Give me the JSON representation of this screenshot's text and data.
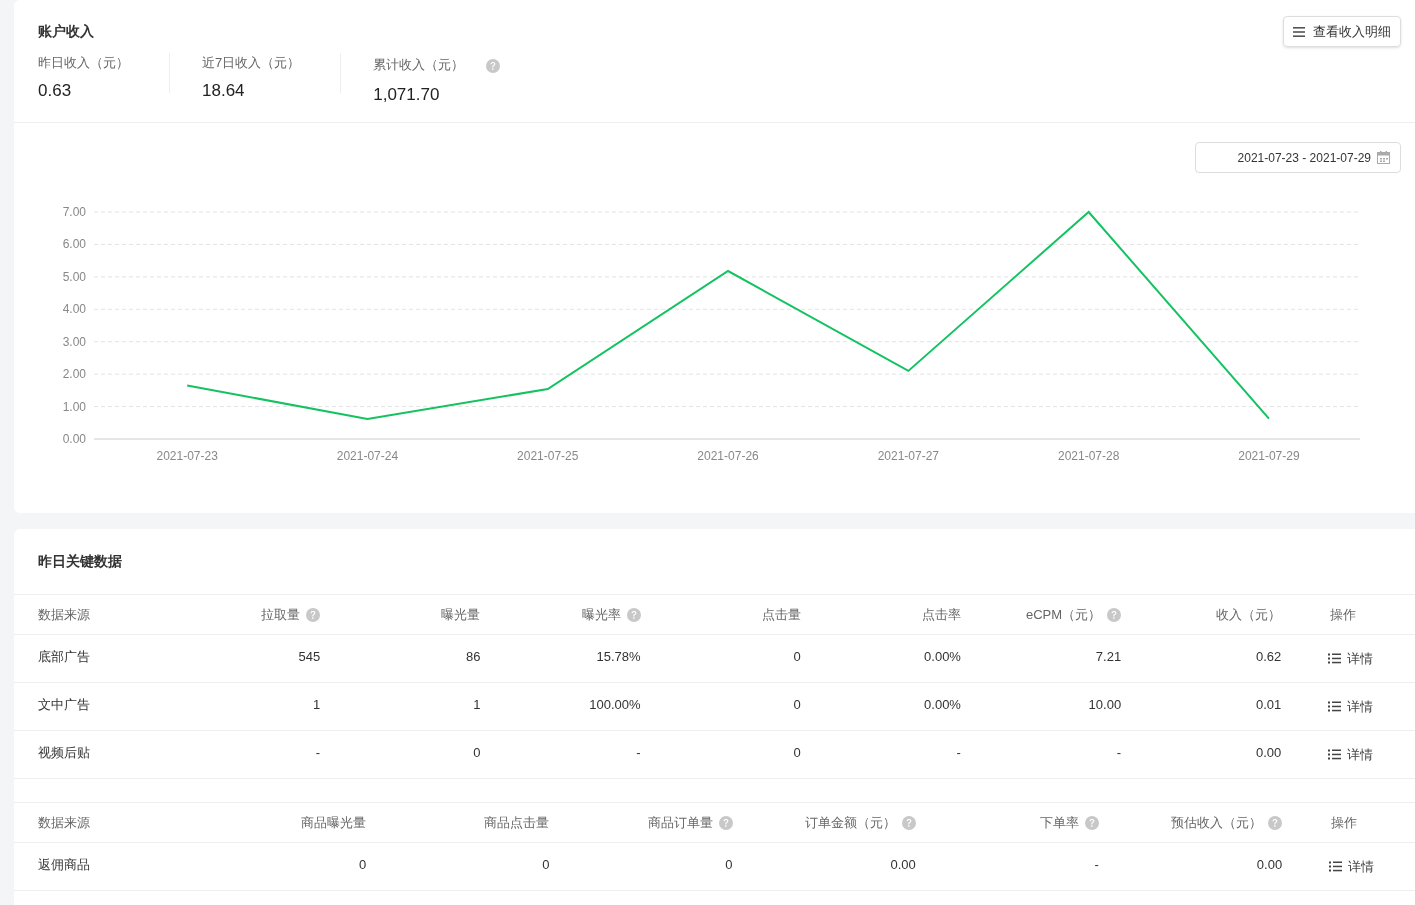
{
  "income": {
    "title": "账户收入",
    "detail_button": "查看收入明细",
    "stats": [
      {
        "label": "昨日收入（元）",
        "value": "0.63",
        "help": false
      },
      {
        "label": "近7日收入（元）",
        "value": "18.64",
        "help": false
      },
      {
        "label": "累计收入（元）",
        "value": "1,071.70",
        "help": true
      }
    ],
    "date_range": "2021-07-23 - 2021-07-29",
    "chart_data": {
      "type": "line",
      "categories": [
        "2021-07-23",
        "2021-07-24",
        "2021-07-25",
        "2021-07-26",
        "2021-07-27",
        "2021-07-28",
        "2021-07-29"
      ],
      "grid": true,
      "series": [
        {
          "color": "#13c261",
          "values": [
            1.65,
            0.62,
            1.54,
            5.18,
            2.1,
            7.0,
            0.63
          ]
        }
      ],
      "ylim": [
        0,
        7
      ],
      "yticks": [
        {
          "value": 0,
          "label": "0.00"
        },
        {
          "value": 1,
          "label": "1.00"
        },
        {
          "value": 2,
          "label": "2.00"
        },
        {
          "value": 3,
          "label": "3.00"
        },
        {
          "value": 4,
          "label": "4.00"
        },
        {
          "value": 5,
          "label": "5.00"
        },
        {
          "value": 6,
          "label": "6.00"
        },
        {
          "value": 7,
          "label": "7.00"
        }
      ]
    }
  },
  "key_data": {
    "title": "昨日关键数据",
    "tables": [
      {
        "columns": [
          {
            "label": "数据来源",
            "help": false
          },
          {
            "label": "拉取量",
            "help": true
          },
          {
            "label": "曝光量",
            "help": false
          },
          {
            "label": "曝光率",
            "help": true
          },
          {
            "label": "点击量",
            "help": false
          },
          {
            "label": "点击率",
            "help": false
          },
          {
            "label": "eCPM（元）",
            "help": true
          },
          {
            "label": "收入（元）",
            "help": false
          },
          {
            "label": "操作",
            "help": false
          }
        ],
        "rows": [
          {
            "cells": [
              "底部广告",
              "545",
              "86",
              "15.78%",
              "0",
              "0.00%",
              "7.21",
              "0.62"
            ],
            "action": "详情"
          },
          {
            "cells": [
              "文中广告",
              "1",
              "1",
              "100.00%",
              "0",
              "0.00%",
              "10.00",
              "0.01"
            ],
            "action": "详情"
          },
          {
            "cells": [
              "视频后贴",
              "-",
              "0",
              "-",
              "0",
              "-",
              "-",
              "0.00"
            ],
            "action": "详情"
          }
        ]
      },
      {
        "columns": [
          {
            "label": "数据来源",
            "help": false
          },
          {
            "label": "商品曝光量",
            "help": false
          },
          {
            "label": "商品点击量",
            "help": false
          },
          {
            "label": "商品订单量",
            "help": true
          },
          {
            "label": "订单金额（元）",
            "help": true
          },
          {
            "label": "下单率",
            "help": true
          },
          {
            "label": "预估收入（元）",
            "help": true
          },
          {
            "label": "操作",
            "help": false
          }
        ],
        "rows": [
          {
            "cells": [
              "返佣商品",
              "0",
              "0",
              "0",
              "0.00",
              "-",
              "0.00"
            ],
            "action": "详情"
          }
        ]
      }
    ]
  }
}
